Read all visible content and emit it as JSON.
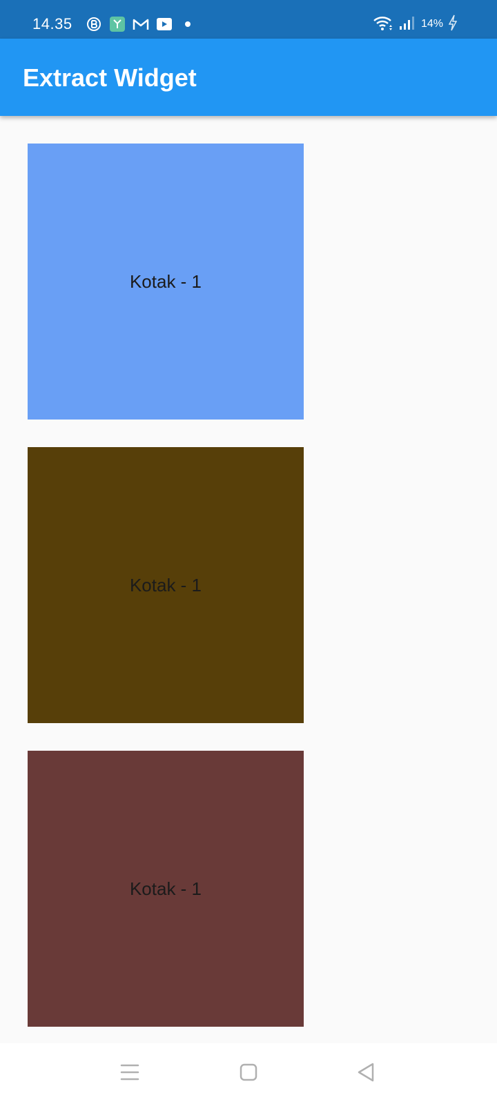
{
  "status_bar": {
    "time": "14.35",
    "battery": "14%",
    "icons": [
      "b-app-icon",
      "box-app-icon",
      "gmail-icon",
      "youtube-icon",
      "dot-icon",
      "wifi-icon",
      "signal-icon",
      "charging-icon"
    ]
  },
  "app_bar": {
    "title": "Extract Widget"
  },
  "boxes": [
    {
      "label": "Kotak - 1",
      "color": "#699ff5"
    },
    {
      "label": "Kotak - 1",
      "color": "#573f09"
    },
    {
      "label": "Kotak - 1",
      "color": "#693a38"
    }
  ],
  "colors": {
    "status_bar": "#1a70b8",
    "app_bar": "#2196f3",
    "background": "#fafafa"
  },
  "nav_bar": {
    "icons": [
      "menu-icon",
      "home-icon",
      "back-icon"
    ]
  }
}
